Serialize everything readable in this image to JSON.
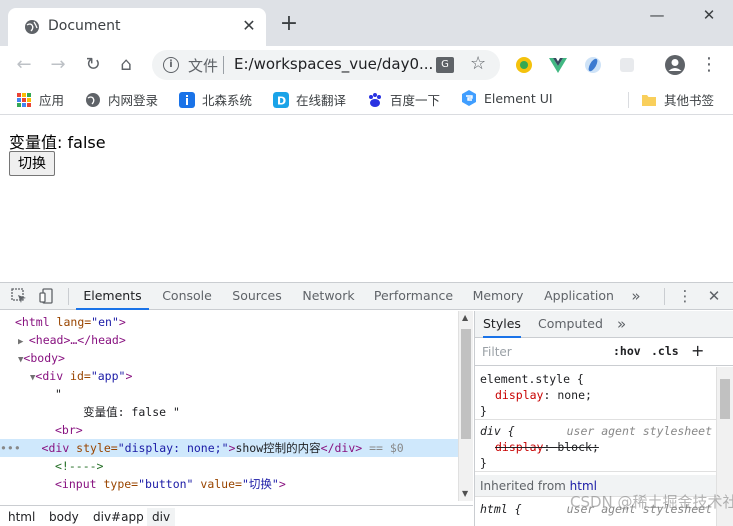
{
  "tab": {
    "title": "Document",
    "close": "✕",
    "new_tab": "+"
  },
  "window_controls": {
    "minimize": "—",
    "maximize": "☐",
    "close": "✕"
  },
  "toolbar": {
    "back": "←",
    "forward": "→",
    "reload": "↻",
    "home": "⌂",
    "omnibox_scheme": "文件",
    "omnibox_url": "E:/workspaces_vue/day0...",
    "star": "☆",
    "menu": "⋮"
  },
  "bookmarks": [
    {
      "label": "应用",
      "icon": "apps-grid-icon",
      "color": "#4285f4"
    },
    {
      "label": "内网登录",
      "icon": "globe-icon",
      "color": "#5f6368"
    },
    {
      "label": "北森系统",
      "icon": "info-badge-icon",
      "color": "#1a73e8"
    },
    {
      "label": "在线翻译",
      "icon": "translate-d-icon",
      "color": "#1aa3e8"
    },
    {
      "label": "百度一下",
      "icon": "baidu-paw-icon",
      "color": "#2932e1"
    },
    {
      "label": "Element UI",
      "icon": "element-logo-icon",
      "color": "#409eff"
    },
    {
      "label": "其他书签",
      "icon": "folder-icon",
      "color": "#f9cf5b"
    }
  ],
  "page": {
    "var_label": "变量值:",
    "var_value": "false",
    "button_label": "切换"
  },
  "devtools": {
    "tabs": [
      "Elements",
      "Console",
      "Sources",
      "Network",
      "Performance",
      "Memory",
      "Application"
    ],
    "more": "»",
    "menu": "⋮",
    "close": "✕",
    "elements_lines": {
      "l1_tag": "<html",
      "l1_attr": " lang=",
      "l1_val": "\"en\"",
      "l1_end": ">",
      "l2": "<head>…</head>",
      "l3": "<body>",
      "l4_tag": "<div",
      "l4_attr": " id=",
      "l4_val": "\"app\"",
      "l4_end": ">",
      "l5": "\"",
      "l6": "            变量值: false \"",
      "l7": "<br>",
      "l8_tag": "<div",
      "l8_attr": " style=",
      "l8_val": "\"display: none;\"",
      "l8_end": ">",
      "l8_text": "show控制的内容",
      "l8_close": "</div>",
      "l8_ref": " == $0",
      "l9": "<!---->",
      "l10_tag": "<input",
      "l10_attr1": " type=",
      "l10_val1": "\"button\"",
      "l10_attr2": " value=",
      "l10_val2": "\"切换\"",
      "l10_end": ">"
    },
    "breadcrumbs": [
      "html",
      "body",
      "div#app",
      "div"
    ],
    "styles": {
      "tabs": [
        "Styles",
        "Computed"
      ],
      "more": "»",
      "filter_placeholder": "Filter",
      "hov": ":hov",
      "cls": ".cls",
      "add": "+",
      "rule1_selector": "element.style {",
      "rule1_prop": "display",
      "rule1_value": "none;",
      "rule_close": "}",
      "rule2_selector": "div {",
      "rule2_source": "user agent stylesheet",
      "rule2_prop": "display",
      "rule2_value": "block;",
      "inherited_label": "Inherited from ",
      "inherited_link": "html",
      "rule3_selector": "html {",
      "rule3_source": "user agent stylesheet"
    }
  },
  "watermark": "CSDN @稀土掘金技术社区"
}
